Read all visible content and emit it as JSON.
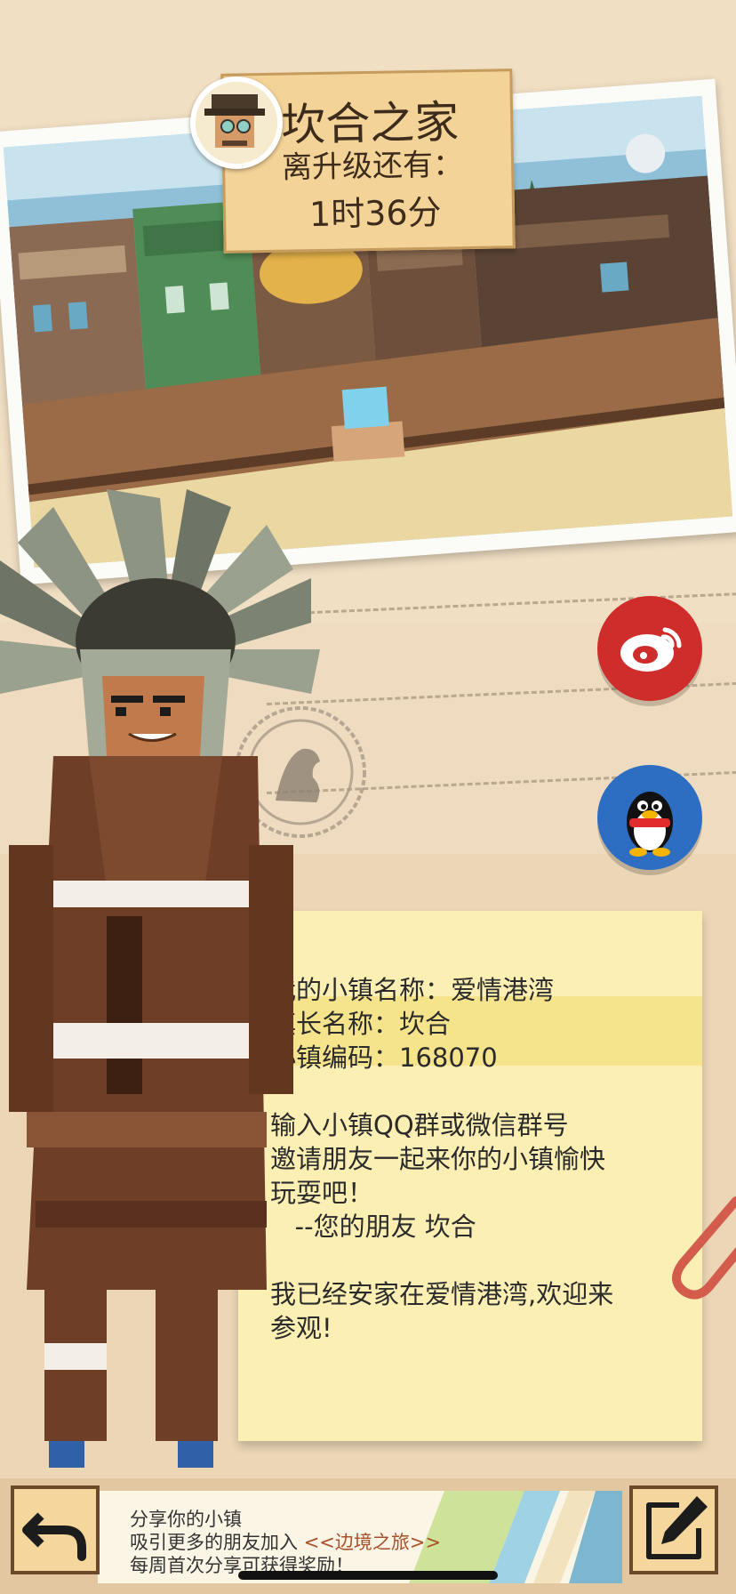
{
  "header": {
    "town_title": "坎合之家",
    "upgrade_label": "离升级还有：",
    "upgrade_time": "1时36分"
  },
  "share": {
    "weibo_icon": "weibo-icon",
    "qq_icon": "qq-penguin-icon"
  },
  "note": {
    "lines": [
      "我的小镇名称：爱情港湾",
      "镇长名称：坎合",
      "小镇编码：168070",
      "",
      "输入小镇QQ群或微信群号",
      "邀请朋友一起来你的小镇愉快",
      "玩耍吧！",
      "   --您的朋友 坎合",
      "",
      "我已经安家在爱情港湾,欢迎来",
      "参观!"
    ]
  },
  "footer": {
    "line1": "分享你的小镇",
    "line2_prefix": "吸引更多的朋友加入 ",
    "line2_highlight": "<<边境之旅>>",
    "line3": "每周首次分享可获得奖励！",
    "back_icon": "back-arrow-icon",
    "edit_icon": "edit-pencil-icon"
  },
  "colors": {
    "background": "#efdcc0",
    "weibo_red": "#cf2d2b",
    "qq_blue": "#2e6ec2",
    "note_yellow": "#fbefb4",
    "highlight_text": "#a9512a"
  }
}
